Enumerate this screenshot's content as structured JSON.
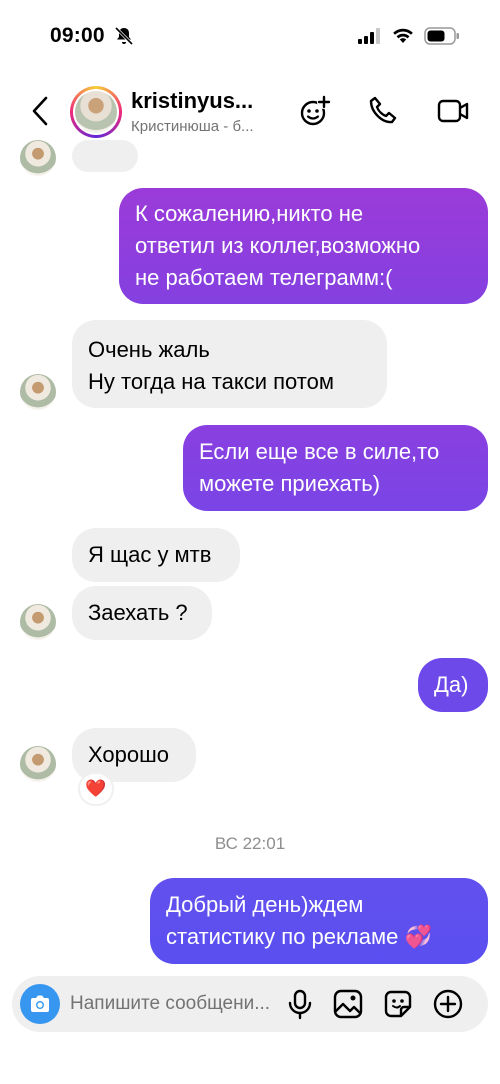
{
  "status": {
    "time": "09:00"
  },
  "header": {
    "name": "kristinyus...",
    "subtitle": "Кристинюша - б..."
  },
  "messages": {
    "m1": {
      "lines": [
        "К сожалению,никто не",
        "ответил из коллег,возможно",
        "не работаем телеграмм:("
      ]
    },
    "m2": {
      "lines": [
        "Очень жаль",
        "Ну тогда на такси потом"
      ]
    },
    "m3": {
      "lines": [
        "Если еще все в силе,то",
        "можете приехать)"
      ]
    },
    "m4": {
      "lines": [
        "Я щас у мтв"
      ]
    },
    "m5": {
      "lines": [
        "Заехать ?"
      ]
    },
    "m6": {
      "lines": [
        "Да)"
      ]
    },
    "m7": {
      "lines": [
        "Хорошо"
      ],
      "reaction": "❤️"
    },
    "m8": {
      "lines": [
        "Добрый день)ждем",
        "статистику по рекламе 💞"
      ]
    }
  },
  "timestamp": "ВС 22:01",
  "composer": {
    "placeholder": "Напишите сообщени..."
  },
  "colors": {
    "out_top": "#9b3bd9",
    "out_bottom": "#5b4ef0",
    "in_bg": "#efefef",
    "camera": "#3797f0"
  },
  "icons": [
    "bell-slash-icon",
    "signal-icon",
    "wifi-icon",
    "battery-icon",
    "back-icon",
    "group-add-icon",
    "phone-icon",
    "video-icon",
    "camera-icon",
    "microphone-icon",
    "image-icon",
    "sticker-icon",
    "plus-icon"
  ]
}
